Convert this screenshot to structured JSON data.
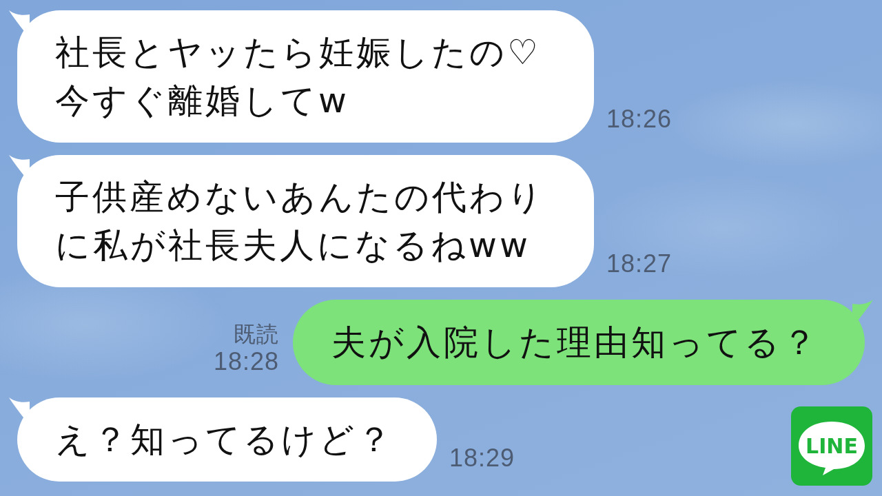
{
  "chat": {
    "messages": [
      {
        "kind": "received",
        "text": "社長とヤッたら妊娠したの♡今すぐ離婚してw",
        "time": "18:26"
      },
      {
        "kind": "received",
        "text": "子供産めないあんたの代わりに私が社長夫人になるねww",
        "time": "18:27"
      },
      {
        "kind": "sent",
        "text": "夫が入院した理由知ってる？",
        "read_receipt": "既読",
        "time": "18:28"
      },
      {
        "kind": "received",
        "text": "え？知ってるけど？",
        "time": "18:29"
      }
    ]
  },
  "logo": {
    "text": "LINE"
  }
}
